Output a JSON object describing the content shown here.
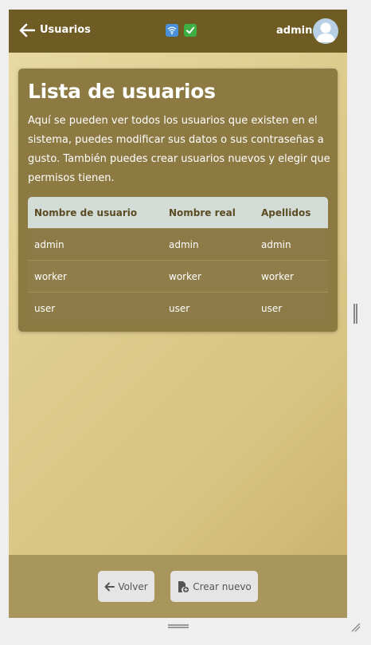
{
  "header": {
    "title": "Usuarios",
    "username": "admin",
    "icons": [
      "back-arrow-icon",
      "wifi-icon",
      "check-icon",
      "user-avatar-icon"
    ]
  },
  "card": {
    "title": "Lista de usuarios",
    "description": "Aquí se pueden ver todos los usuarios que existen en el sistema, puedes modificar sus datos o sus contraseñas a gusto. También puedes crear usuarios nuevos y elegir que permisos tienen."
  },
  "table": {
    "headers": [
      "Nombre de usuario",
      "Nombre real",
      "Apellidos"
    ],
    "rows": [
      [
        "admin",
        "admin",
        "admin"
      ],
      [
        "worker",
        "worker",
        "worker"
      ],
      [
        "user",
        "user",
        "user"
      ]
    ]
  },
  "footer": {
    "back_label": "Volver",
    "new_label": "Crear nuevo"
  },
  "colors": {
    "header": "#6f5c25",
    "card": "#8c7a42",
    "footer": "#a8965c",
    "table_header": "#d4dcd8"
  }
}
